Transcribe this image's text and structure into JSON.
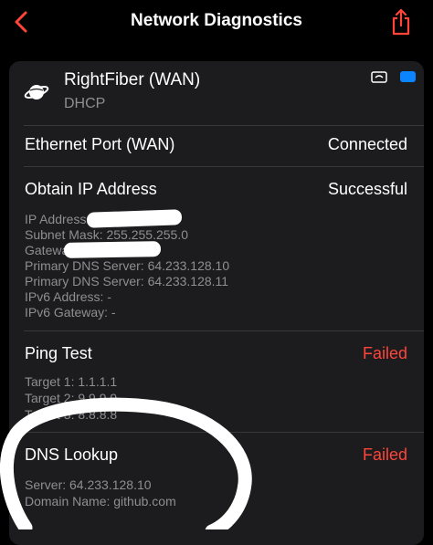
{
  "header": {
    "title": "Network Diagnostics",
    "back_icon": "chevron-left-icon",
    "share_icon": "share-icon",
    "accent": "#ff453a"
  },
  "wan": {
    "name": "RightFiber (WAN)",
    "type": "DHCP",
    "icon": "globe-icon"
  },
  "ethernet": {
    "label": "Ethernet Port (WAN)",
    "status": "Connected"
  },
  "obtain_ip": {
    "label": "Obtain IP Address",
    "status": "Successful",
    "details": [
      "IP Address:",
      "Subnet Mask: 255.255.255.0",
      "Gateway:",
      "Primary DNS Server: 64.233.128.10",
      "Primary DNS Server: 64.233.128.11",
      "IPv6 Address: -",
      "IPv6 Gateway: -"
    ]
  },
  "ping": {
    "label": "Ping Test",
    "status": "Failed",
    "details": [
      "Target 1: 1.1.1.1",
      "Target 2: 9.9.9.9",
      "Target 3: 8.8.8.8"
    ]
  },
  "dns": {
    "label": "DNS Lookup",
    "status": "Failed",
    "details": [
      "Server: 64.233.128.10",
      "Domain Name: github.com"
    ]
  },
  "colors": {
    "failed": "#ff453a",
    "secondary_text": "#8e8e93",
    "card": "#1c1c1e",
    "toggle_blue": "#0a84ff"
  }
}
